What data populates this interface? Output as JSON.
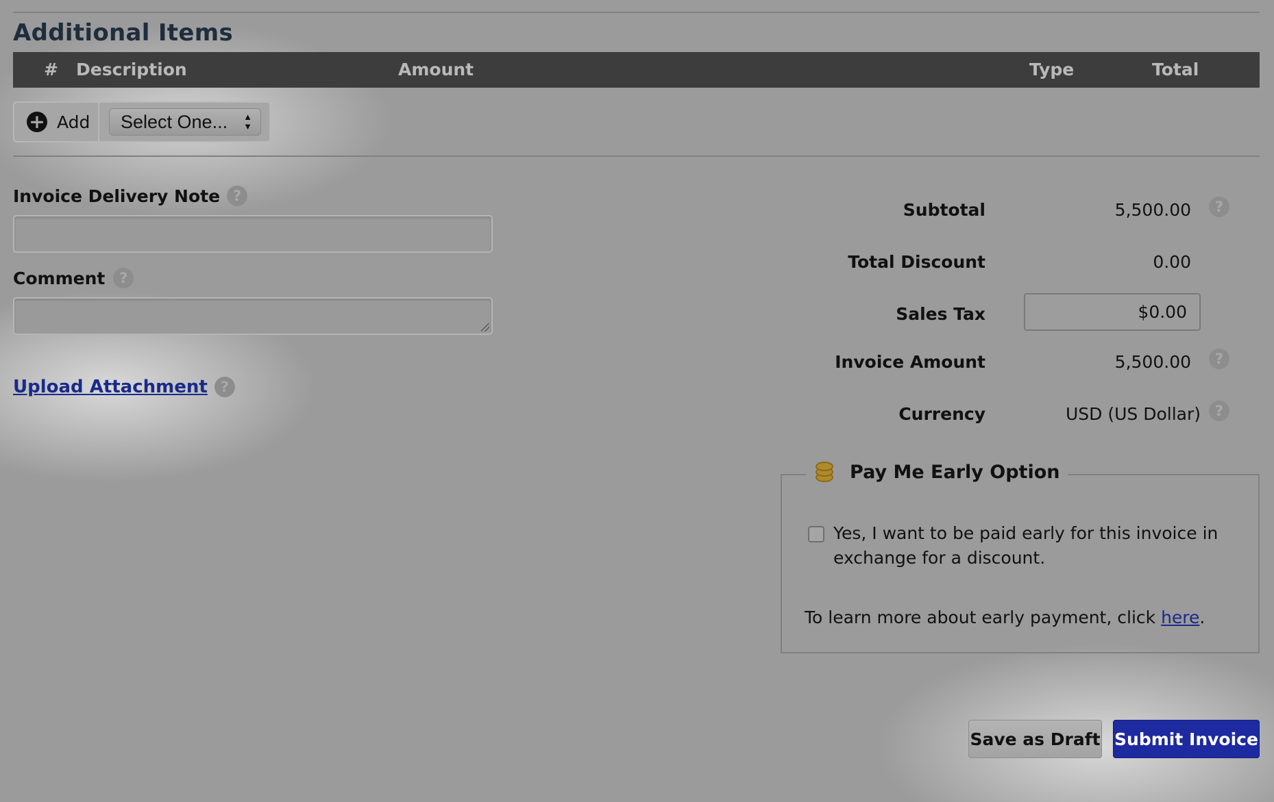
{
  "additional_items": {
    "title": "Additional Items",
    "columns": {
      "number": "#",
      "description": "Description",
      "amount": "Amount",
      "type": "Type",
      "total": "Total"
    },
    "add_label": "Add",
    "select_value": "Select One..."
  },
  "form": {
    "delivery_note_label": "Invoice Delivery Note",
    "delivery_note_value": "",
    "comment_label": "Comment",
    "comment_value": "",
    "upload_label": "Upload Attachment",
    "help_glyph": "?"
  },
  "summary": {
    "subtotal_label": "Subtotal",
    "subtotal_value": "5,500.00",
    "discount_label": "Total Discount",
    "discount_value": "0.00",
    "tax_label": "Sales Tax",
    "tax_value": "$0.00",
    "invoice_amount_label": "Invoice Amount",
    "invoice_amount_value": "5,500.00",
    "currency_label": "Currency",
    "currency_value": "USD (US Dollar)"
  },
  "early_pay": {
    "title": "Pay Me Early Option",
    "checkbox_checked": false,
    "checkbox_text_line1": "Yes, I want to be paid early for this invoice in",
    "checkbox_text_line2": "exchange for a discount.",
    "learn_more_prefix": "To learn more about early payment, click ",
    "learn_more_link": "here",
    "learn_more_suffix": "."
  },
  "actions": {
    "save_draft": "Save as Draft",
    "submit": "Submit Invoice"
  },
  "colors": {
    "submit_button": "#1d2aa0",
    "link": "#1a2a8a",
    "table_header": "#3d3d3d"
  }
}
